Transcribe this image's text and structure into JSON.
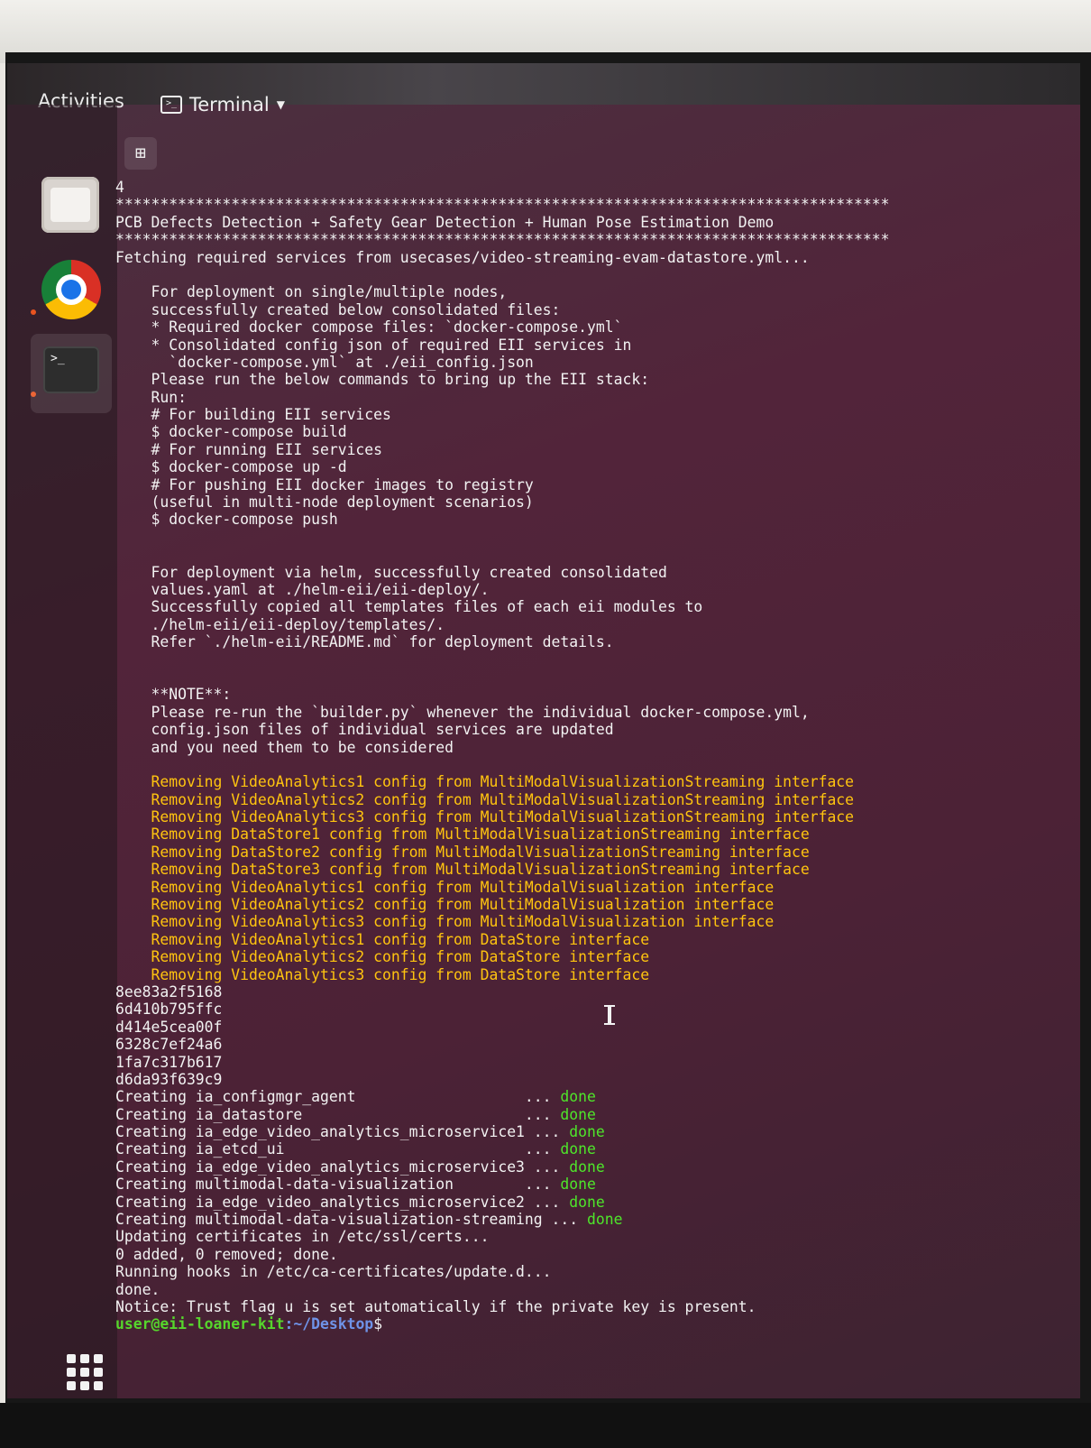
{
  "topbar": {
    "activities": "Activities",
    "app_name": "Terminal"
  },
  "dock": {
    "items": [
      "files",
      "chrome",
      "terminal",
      "show-applications"
    ]
  },
  "terminal": {
    "lines": [
      "4",
      "***************************************************************************************",
      "PCB Defects Detection + Safety Gear Detection + Human Pose Estimation Demo",
      "***************************************************************************************",
      "Fetching required services from usecases/video-streaming-evam-datastore.yml...",
      "",
      "    For deployment on single/multiple nodes,",
      "    successfully created below consolidated files:",
      "    * Required docker compose files: `docker-compose.yml`",
      "    * Consolidated config json of required EII services in",
      "      `docker-compose.yml` at ./eii_config.json",
      "    Please run the below commands to bring up the EII stack:",
      "    Run:",
      "    # For building EII services",
      "    $ docker-compose build",
      "    # For running EII services",
      "    $ docker-compose up -d",
      "    # For pushing EII docker images to registry",
      "    (useful in multi-node deployment scenarios)",
      "    $ docker-compose push",
      "",
      "",
      "    For deployment via helm, successfully created consolidated",
      "    values.yaml at ./helm-eii/eii-deploy/.",
      "    Successfully copied all templates files of each eii modules to",
      "    ./helm-eii/eii-deploy/templates/.",
      "    Refer `./helm-eii/README.md` for deployment details.",
      "",
      "",
      "    **NOTE**:",
      "    Please re-run the `builder.py` whenever the individual docker-compose.yml,",
      "    config.json files of individual services are updated",
      "    and you need them to be considered",
      ""
    ],
    "warnings": [
      "    Removing VideoAnalytics1 config from MultiModalVisualizationStreaming interface",
      "    Removing VideoAnalytics2 config from MultiModalVisualizationStreaming interface",
      "    Removing VideoAnalytics3 config from MultiModalVisualizationStreaming interface",
      "    Removing DataStore1 config from MultiModalVisualizationStreaming interface",
      "    Removing DataStore2 config from MultiModalVisualizationStreaming interface",
      "    Removing DataStore3 config from MultiModalVisualizationStreaming interface",
      "    Removing VideoAnalytics1 config from MultiModalVisualization interface",
      "    Removing VideoAnalytics2 config from MultiModalVisualization interface",
      "    Removing VideoAnalytics3 config from MultiModalVisualization interface",
      "    Removing VideoAnalytics1 config from DataStore interface",
      "    Removing VideoAnalytics2 config from DataStore interface",
      "    Removing VideoAnalytics3 config from DataStore interface"
    ],
    "ids": [
      "8ee83a2f5168",
      "6d410b795ffc",
      "d414e5cea00f",
      "6328c7ef24a6",
      "1fa7c317b617",
      "d6da93f639c9"
    ],
    "creating": [
      {
        "text": "Creating ia_configmgr_agent                   ... ",
        "status": "done"
      },
      {
        "text": "Creating ia_datastore                         ... ",
        "status": "done"
      },
      {
        "text": "Creating ia_edge_video_analytics_microservice1 ... ",
        "status": "done"
      },
      {
        "text": "Creating ia_etcd_ui                           ... ",
        "status": "done"
      },
      {
        "text": "Creating ia_edge_video_analytics_microservice3 ... ",
        "status": "done"
      },
      {
        "text": "Creating multimodal-data-visualization        ... ",
        "status": "done"
      },
      {
        "text": "Creating ia_edge_video_analytics_microservice2 ... ",
        "status": "done"
      },
      {
        "text": "Creating multimodal-data-visualization-streaming ... ",
        "status": "done"
      }
    ],
    "tail": [
      "Updating certificates in /etc/ssl/certs...",
      "0 added, 0 removed; done.",
      "Running hooks in /etc/ca-certificates/update.d...",
      "done.",
      "Notice: Trust flag u is set automatically if the private key is present."
    ],
    "prompt": {
      "user_host": "user@eii-loaner-kit",
      "path": ":~/Desktop",
      "symbol": "$"
    }
  },
  "colors": {
    "warning": "#ffc40f",
    "success": "#4ee62a",
    "prompt_user": "#56d62c",
    "prompt_path": "#6f93e8",
    "background": "#52243a"
  }
}
